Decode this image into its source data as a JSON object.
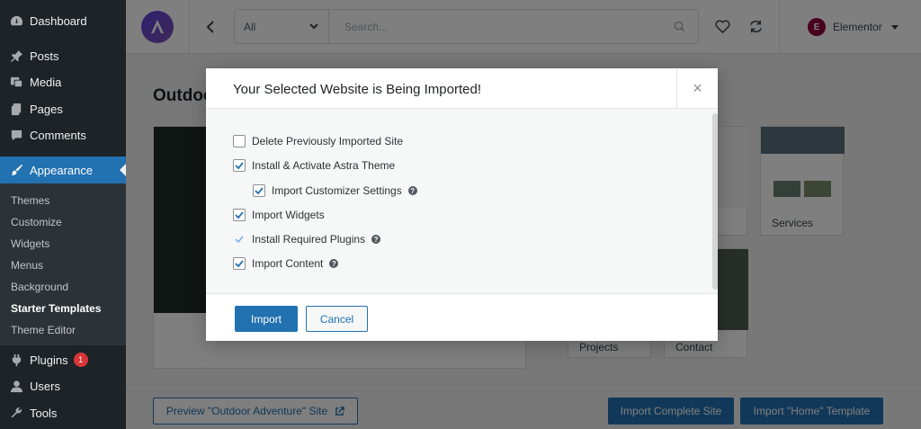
{
  "sidebar": {
    "items": [
      {
        "label": "Dashboard",
        "icon": "dashboard-icon"
      },
      {
        "label": "Posts",
        "icon": "pin-icon"
      },
      {
        "label": "Media",
        "icon": "media-icon"
      },
      {
        "label": "Pages",
        "icon": "pages-icon"
      },
      {
        "label": "Comments",
        "icon": "comment-icon"
      },
      {
        "label": "Appearance",
        "icon": "brush-icon"
      },
      {
        "label": "Plugins",
        "icon": "plugin-icon",
        "badge": "1"
      },
      {
        "label": "Users",
        "icon": "user-icon"
      },
      {
        "label": "Tools",
        "icon": "wrench-icon"
      }
    ],
    "submenu": [
      "Themes",
      "Customize",
      "Widgets",
      "Menus",
      "Background",
      "Starter Templates",
      "Theme Editor"
    ]
  },
  "topbar": {
    "category": "All",
    "search_placeholder": "Search...",
    "builder": "Elementor",
    "builder_icon": "E"
  },
  "background": {
    "page_title": "Outdoor Adventure",
    "thumbs": [
      "Services",
      "Projects",
      "Contact"
    ],
    "preview_button": "Preview \"Outdoor Adventure\" Site",
    "import_complete": "Import Complete Site",
    "import_home": "Import \"Home\" Template"
  },
  "modal": {
    "title": "Your Selected Website is Being Imported!",
    "close": "×",
    "options": [
      {
        "label": "Delete Previously Imported Site",
        "checked": false,
        "help": false
      },
      {
        "label": "Install & Activate Astra Theme",
        "checked": true,
        "help": false
      },
      {
        "label": "Import Customizer Settings",
        "checked": true,
        "help": true
      },
      {
        "label": "Import Widgets",
        "checked": true,
        "help": false
      },
      {
        "label": "Install Required Plugins",
        "checked": true,
        "help": true,
        "plain": true
      },
      {
        "label": "Import Content",
        "checked": true,
        "help": true
      }
    ],
    "import_button": "Import",
    "cancel_button": "Cancel"
  },
  "colors": {
    "accent": "#2271b1",
    "sidebar_bg": "#1d2327",
    "submenu_bg": "#2c3338",
    "badge": "#d63638",
    "elementor": "#92003b"
  }
}
